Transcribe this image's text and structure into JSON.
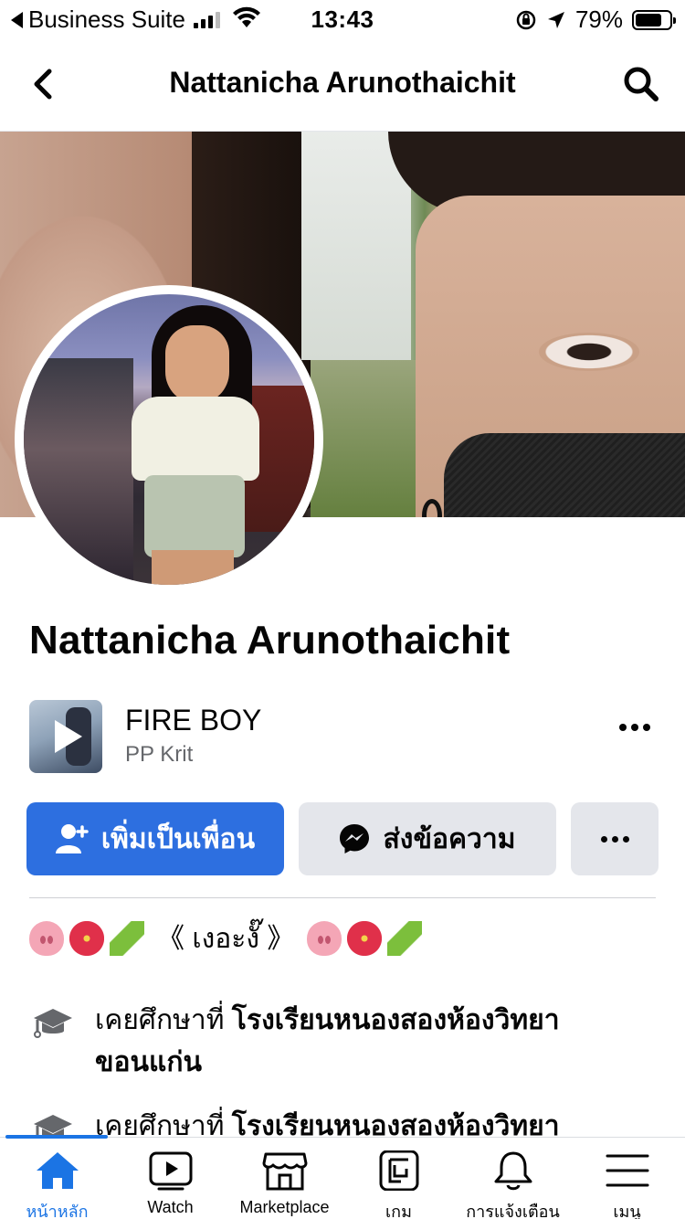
{
  "status_bar": {
    "back_app": "Business Suite",
    "time": "13:43",
    "battery": "79%",
    "battery_level": 0.79
  },
  "header": {
    "title": "Nattanicha Arunothaichit"
  },
  "profile": {
    "name": "Nattanicha Arunothaichit"
  },
  "music": {
    "title": "FIRE BOY",
    "artist": "PP Krit"
  },
  "actions": {
    "add_friend": "เพิ่มเป็นเพื่อน",
    "message": "ส่งข้อความ"
  },
  "bio": {
    "text": "《 เงอะงั๊ 》"
  },
  "info": [
    {
      "prefix": "เคยศึกษาที่ ",
      "value": "โรงเรียนหนองสองห้องวิทยา ขอนแก่น",
      "icon": "graduation-cap-icon"
    },
    {
      "prefix": "เคยศึกษาที่ ",
      "value": "โรงเรียนหนองสองห้องวิทยา",
      "icon": "graduation-cap-icon"
    }
  ],
  "bottom_nav": [
    {
      "label": "หน้าหลัก",
      "icon": "home-icon",
      "active": true
    },
    {
      "label": "Watch",
      "icon": "watch-icon",
      "active": false
    },
    {
      "label": "Marketplace",
      "icon": "marketplace-icon",
      "active": false
    },
    {
      "label": "เกม",
      "icon": "gaming-icon",
      "active": false
    },
    {
      "label": "การแจ้งเตือน",
      "icon": "bell-icon",
      "active": false
    },
    {
      "label": "เมนู",
      "icon": "menu-icon",
      "active": false
    }
  ],
  "colors": {
    "accent": "#1b74e4",
    "add_button": "#2d6fe0",
    "secondary_button": "#e4e6eb"
  }
}
